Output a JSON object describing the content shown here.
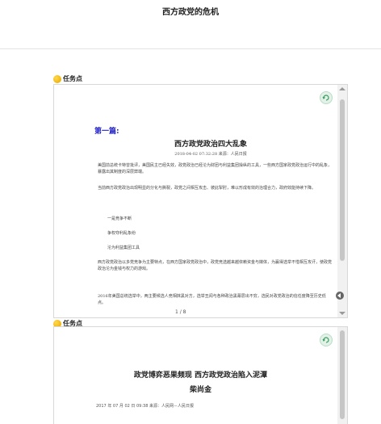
{
  "page": {
    "title": "西方政党的危机"
  },
  "tasks": [
    {
      "heading": "任务点",
      "doc": {
        "section_label": "第一篇:",
        "title": "西方政党政治四大乱象",
        "meta": "2018-04-02 07:32:28 来源：人民日报",
        "paragraphs": [
          "美国前总统卡特曾批评，美国民主已经失效，政党政治已经沦为财团与利益集团操纵的工具，一些西方国家政党政治运行中的乱象，暴露出其制度的深层弊端。",
          "当前西方政党政治出现明显的分化与撕裂，政党之间相互攻击、彼此掣肘，难以形成有效的治理合力，政府效能持续下降。",
          "一是竞争不断",
          "争权夺利乱象纷",
          "沦为利益集团工具",
          "西方政党政治以多党竞争为主要特点，在西方国家政党政治中，政党竞选越来越依赖资金与媒体，为赢得选举不惜相互攻讦，使政党政治沦为金钱与权力的游戏。",
          "2016年美国总统选举中，两主要候选人竞相抹黑对方，选举丑闻与各种政治黑幕层出不穷，选民对政党政治的信任度降至历史低点。"
        ],
        "page_indicator": "1 / 8"
      }
    },
    {
      "heading": "任务点",
      "doc": {
        "title_line1": "政党博弈恶果频现 西方政党政治陷入泥潭",
        "title_line2": "柴尚金",
        "meta": "2017 年 07 月 02 日 09:38 来源：人民网－人民日报"
      }
    }
  ]
}
